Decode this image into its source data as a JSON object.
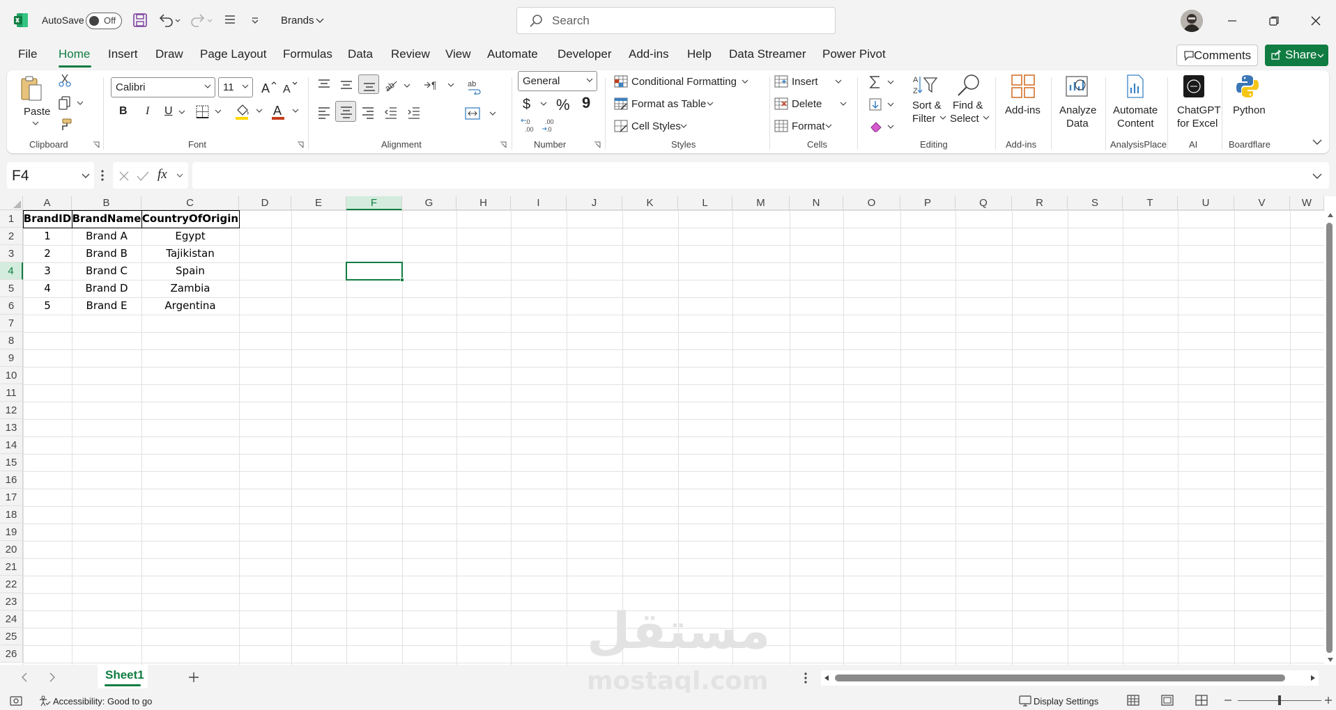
{
  "app": {
    "autosave_label": "AutoSave",
    "autosave_state": "Off",
    "filename": "Brands",
    "search_placeholder": "Search"
  },
  "tabs": [
    "File",
    "Home",
    "Insert",
    "Draw",
    "Page Layout",
    "Formulas",
    "Data",
    "Review",
    "View",
    "Automate",
    "Developer",
    "Add-ins",
    "Help",
    "Data Streamer",
    "Power Pivot"
  ],
  "active_tab": "Home",
  "header_buttons": {
    "comments": "Comments",
    "share": "Share"
  },
  "ribbon": {
    "clipboard": {
      "paste": "Paste",
      "group": "Clipboard"
    },
    "font": {
      "name": "Calibri",
      "size": "11",
      "group": "Font",
      "bold": "B",
      "italic": "I",
      "underline": "U"
    },
    "alignment": {
      "group": "Alignment"
    },
    "number": {
      "format": "General",
      "currency": "$",
      "percent": "%",
      "comma": "9",
      "group": "Number"
    },
    "styles": {
      "conditional": "Conditional Formatting",
      "format_table": "Format as Table",
      "cell_styles": "Cell Styles",
      "group": "Styles"
    },
    "cells": {
      "insert": "Insert",
      "delete": "Delete",
      "format": "Format",
      "group": "Cells"
    },
    "editing": {
      "sort1": "Sort &",
      "sort2": "Filter",
      "find1": "Find &",
      "find2": "Select",
      "group": "Editing"
    },
    "addins": {
      "label": "Add-ins",
      "group": "Add-ins"
    },
    "analyze": {
      "line1": "Analyze",
      "line2": "Data"
    },
    "automate_content": {
      "line1": "Automate",
      "line2": "Content",
      "group": "AnalysisPlace"
    },
    "chatgpt": {
      "line1": "ChatGPT",
      "line2": "for Excel",
      "group": "AI"
    },
    "python": {
      "label": "Python",
      "group": "Boardflare"
    }
  },
  "formula_bar": {
    "name_box": "F4",
    "fx": "fx",
    "content": ""
  },
  "columns": [
    "A",
    "B",
    "C",
    "D",
    "E",
    "F",
    "G",
    "H",
    "I",
    "J",
    "K",
    "L",
    "M",
    "N",
    "O",
    "P",
    "Q",
    "R",
    "S",
    "T",
    "U",
    "V",
    "W"
  ],
  "rows": [
    "1",
    "2",
    "3",
    "4",
    "5",
    "6",
    "7",
    "8",
    "9",
    "10",
    "11",
    "12",
    "13",
    "14",
    "15",
    "16",
    "17",
    "18",
    "19",
    "20",
    "21",
    "22",
    "23",
    "24",
    "25",
    "26"
  ],
  "table": {
    "headers": [
      "BrandID",
      "BrandName",
      "CountryOfOrigin"
    ],
    "rows": [
      [
        "1",
        "Brand A",
        "Egypt"
      ],
      [
        "2",
        "Brand B",
        "Tajikistan"
      ],
      [
        "3",
        "Brand C",
        "Spain"
      ],
      [
        "4",
        "Brand D",
        "Zambia"
      ],
      [
        "5",
        "Brand E",
        "Argentina"
      ]
    ]
  },
  "selected_cell": "F4",
  "sheets": [
    "Sheet1"
  ],
  "status": {
    "accessibility": "Accessibility: Good to go",
    "display_settings": "Display Settings"
  },
  "watermark": {
    "arabic": "مستقل",
    "latin": "mostaql.com"
  },
  "colors": {
    "accent": "#107c41",
    "grid": "#e1e1e1",
    "selection": "#107c41"
  }
}
